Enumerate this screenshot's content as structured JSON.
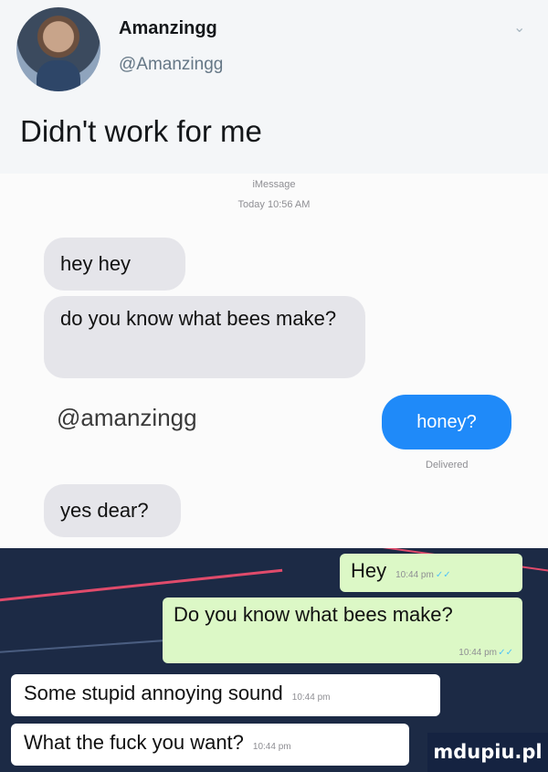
{
  "tweet": {
    "display_name": "Amanzingg",
    "handle": "@Amanzingg",
    "text": "Didn't work for me",
    "menu_icon": "chevron-down-icon"
  },
  "imessage": {
    "service": "iMessage",
    "timestamp": "Today 10:56 AM",
    "messages": [
      {
        "text": "hey hey",
        "direction": "received"
      },
      {
        "text": "do you know what bees make?",
        "direction": "received"
      },
      {
        "text": "honey?",
        "direction": "sent"
      },
      {
        "text": "yes dear?",
        "direction": "received"
      }
    ],
    "mention": "@amanzingg",
    "delivered": "Delivered",
    "colors": {
      "sent": "#1f8af9",
      "received": "#e5e5ea"
    }
  },
  "whatsapp": {
    "messages": [
      {
        "text": "Hey",
        "time": "10:44 pm",
        "direction": "sent",
        "status": "read"
      },
      {
        "text": "Do you know what bees make?",
        "time": "10:44 pm",
        "direction": "sent",
        "status": "read"
      },
      {
        "text": "Some stupid annoying sound",
        "time": "10:44 pm",
        "direction": "received"
      },
      {
        "text": "What the fuck you want?",
        "time": "10:44 pm",
        "direction": "received"
      }
    ],
    "colors": {
      "sent": "#dcf8c6",
      "received": "#ffffff",
      "background": "#1c2a45"
    }
  },
  "watermark": "mdupiu.pl"
}
